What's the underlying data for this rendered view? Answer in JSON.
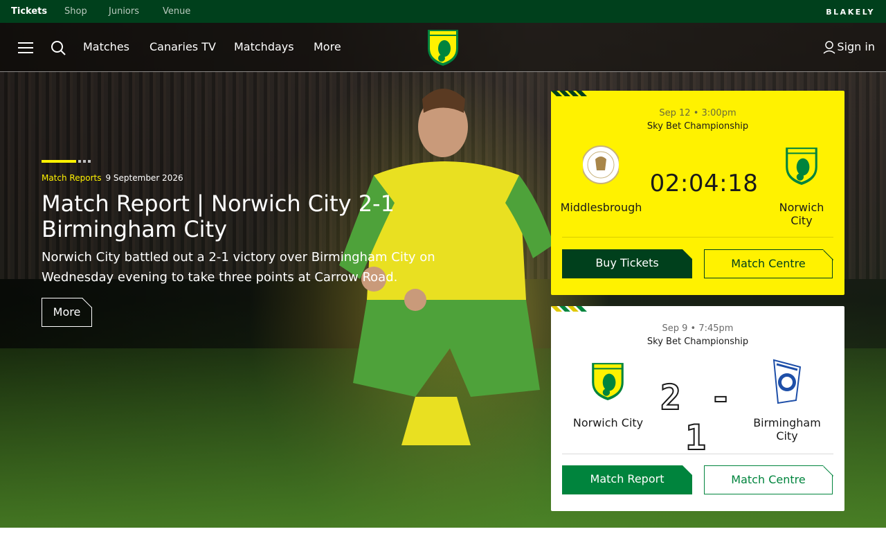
{
  "topbar": {
    "links": [
      "Tickets",
      "Shop",
      "Juniors",
      "Venue"
    ],
    "sponsor": "BLAKELY"
  },
  "nav": {
    "items": [
      "Matches",
      "Canaries TV",
      "Matchdays",
      "More"
    ],
    "signin": "Sign in",
    "icons": [
      "menu-icon",
      "search-icon",
      "user-icon"
    ]
  },
  "hero": {
    "category": "Match Reports",
    "date": "9 September 2026",
    "headline": "Match Report | Norwich City 2-1 Birmingham City",
    "summary": "Norwich City battled out a 2-1 victory over Birmingham City on Wednesday evening to take three points at Carrow Road.",
    "more_label": "More"
  },
  "upcoming": {
    "datetime": "Sep 12 • 3:00pm",
    "competition": "Sky Bet Championship",
    "home": "Middlesbrough",
    "away": "Norwich City",
    "countdown": "02:04:18",
    "buy_label": "Buy Tickets",
    "centre_label": "Match Centre"
  },
  "result": {
    "datetime": "Sep 9 • 7:45pm",
    "competition": "Sky Bet Championship",
    "home": "Norwich City",
    "away": "Birmingham City",
    "score": "2 - 1",
    "report_label": "Match Report",
    "centre_label": "Match Centre"
  },
  "colors": {
    "club_green": "#00843d",
    "dark_green": "#00401c",
    "club_yellow": "#fff200"
  }
}
